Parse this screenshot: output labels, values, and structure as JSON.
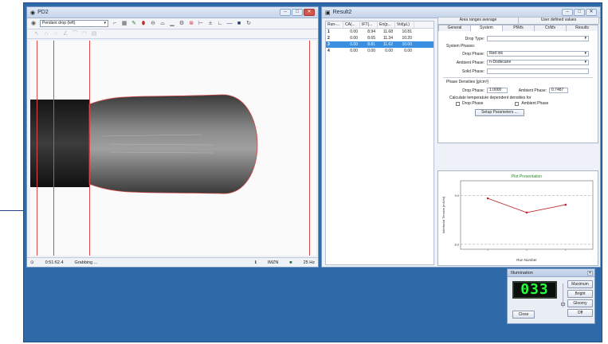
{
  "main": {
    "title": "PD2",
    "mode_select": "Pendant drop (left)",
    "status": {
      "time": "0:51:62.4",
      "state": "Grabbing ...",
      "res": "IMZN",
      "fps": "25 Hz"
    }
  },
  "results": {
    "title": "Result2",
    "columns": [
      "Run-...",
      "CA(...",
      "IFT(...",
      "En(p...",
      "Vol(µL)"
    ],
    "rows": [
      {
        "run": "1",
        "ca": "0.00",
        "ift": "8.94",
        "en": "11.68",
        "vol": "10.81",
        "selected": false
      },
      {
        "run": "2",
        "ca": "0.00",
        "ift": "8.65",
        "en": "11.34",
        "vol": "10.20",
        "selected": false
      },
      {
        "run": "3",
        "ca": "0.00",
        "ift": "8.81",
        "en": "11.62",
        "vol": "10.00",
        "selected": true
      },
      {
        "run": "4",
        "ca": "0.00",
        "ift": "0.00",
        "en": "0.00",
        "vol": "0.00",
        "selected": false
      }
    ],
    "tabs_top": [
      "Area ranges average",
      "User defined values"
    ],
    "tabs_bottom": [
      "General",
      "System",
      "Pf/kfs",
      "Cr/kfs",
      "Results"
    ],
    "form": {
      "drop_type_label": "Drop Type:",
      "system_phases_label": "System Phases:",
      "drop_phase_label": "Drop Phase:",
      "drop_phase_value": "Red ink",
      "ambient_phase_label": "Ambient Phase:",
      "ambient_phase_value": "n-Dodecane",
      "solid_phase_label": "Solid Phase:",
      "densities_label": "Phase Densities [g/cm³]",
      "drop_density_label": "Drop Phase:",
      "drop_density_value": "1.0000",
      "ambient_density_label": "Ambient Phase:",
      "ambient_density_value": "0.7487",
      "calc_label": "Calculate temperature dependent densities for",
      "chk_drop_label": "Drop Phase",
      "chk_ambient_label": "Ambient Phase",
      "setup_button": "Setup Parameters ..."
    }
  },
  "chart_data": {
    "type": "line",
    "title": "Plot Presentation",
    "xlabel": "Run Number",
    "ylabel": "Interfacial Tension [mN/m]",
    "x": [
      1,
      2,
      3
    ],
    "values": [
      8.94,
      8.65,
      8.81
    ],
    "ylim": [
      7.9,
      9.3
    ],
    "ytick_labels": [
      "9.0",
      "8.0"
    ],
    "grid": true
  },
  "illumination": {
    "title": "Illumination",
    "display": "033",
    "buttons": {
      "maximum": "Maximum",
      "bright": "Bright",
      "gloomy": "Gloomy",
      "off": "Off",
      "close": "Close"
    }
  },
  "colors": {
    "desktop": "#2e6aa8",
    "selection": "#3b8fe0",
    "reticle": "#e0474a",
    "led": "#25ff3b",
    "plot_title": "#2a8a2a"
  }
}
